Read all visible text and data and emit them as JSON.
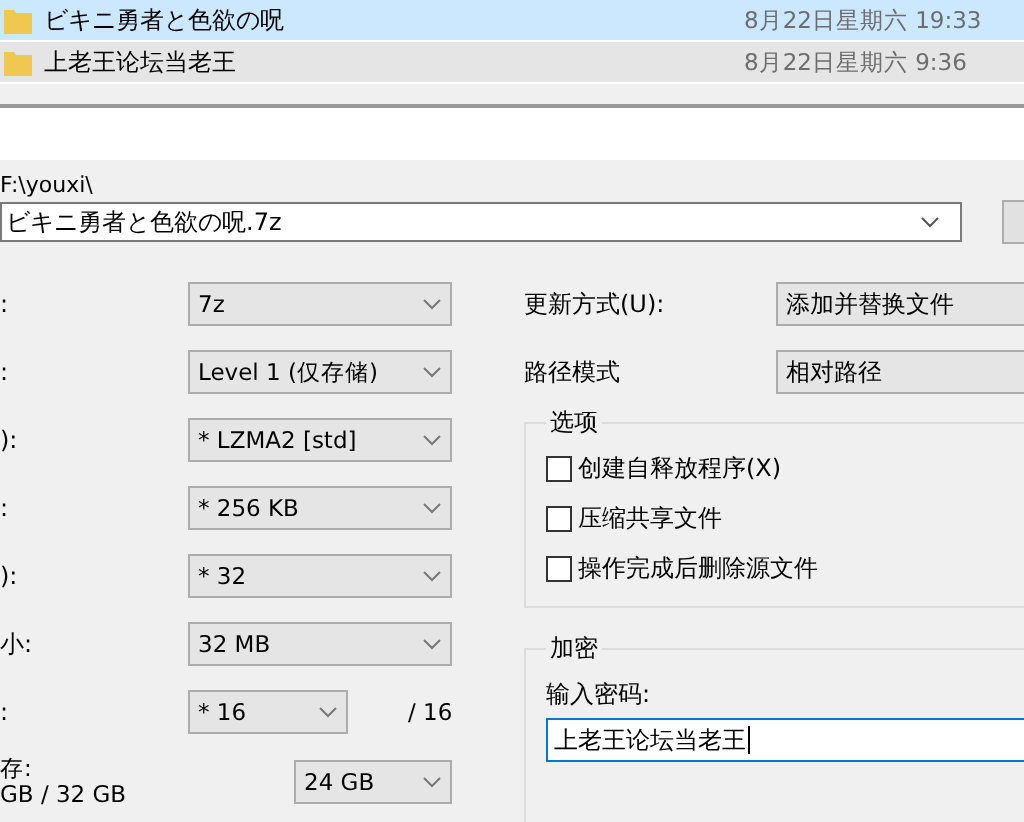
{
  "file_list": [
    {
      "name": "ビキニ勇者と色欲の呪",
      "date": "8月22日星期六 19:33",
      "selected": true
    },
    {
      "name": "上老王论坛当老王",
      "date": "8月22日星期六 9:36",
      "selected": false
    }
  ],
  "archive": {
    "path": "F:\\youxi\\",
    "name": "ビキニ勇者と色欲の呪.7z"
  },
  "left_rows": [
    {
      "label": ":",
      "value": "7z"
    },
    {
      "label": ":",
      "value": "Level 1 (仅存储)"
    },
    {
      "label": "):",
      "value": "* LZMA2 [std]"
    },
    {
      "label": ":",
      "value": "* 256 KB"
    },
    {
      "label": "):",
      "value": "* 32"
    },
    {
      "label": "小:",
      "value": "32 MB"
    },
    {
      "label": ":",
      "value": "* 16",
      "suffix": "/ 16"
    }
  ],
  "memory": {
    "label": "存:",
    "usage": "GB / 32 GB",
    "value": "24 GB"
  },
  "update_mode": {
    "label": "更新方式(U):",
    "value": "添加并替换文件"
  },
  "path_mode": {
    "label": "路径模式",
    "value": "相对路径"
  },
  "options": {
    "title": "选项",
    "items": [
      {
        "label": "创建自释放程序(X)",
        "checked": false
      },
      {
        "label": "压缩共享文件",
        "checked": false
      },
      {
        "label": "操作完成后删除源文件",
        "checked": false
      }
    ]
  },
  "encryption": {
    "title": "加密",
    "password_label": "输入密码:",
    "password": "上老王论坛当老王"
  }
}
